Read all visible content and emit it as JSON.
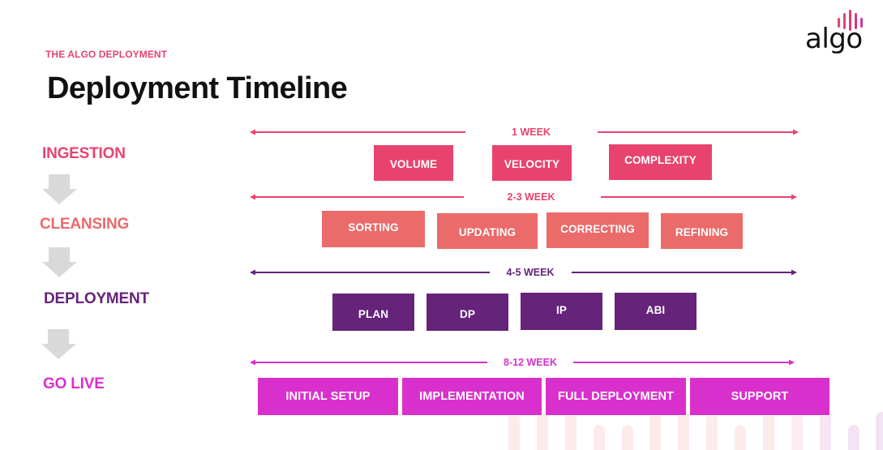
{
  "header": {
    "eyebrow": "THE ALGO DEPLOYMENT",
    "title": "Deployment Timeline",
    "logo_text": "algo"
  },
  "colors": {
    "ingestion": "#e8436e",
    "cleansing": "#eb6a6a",
    "deployment": "#66237a",
    "golive": "#d930cd",
    "connector": "#d9d9d9"
  },
  "stages": [
    {
      "label": "INGESTION"
    },
    {
      "label": "CLEANSING"
    },
    {
      "label": "DEPLOYMENT"
    },
    {
      "label": "GO LIVE"
    }
  ],
  "timeline": [
    {
      "duration": "1 WEEK",
      "steps": [
        "VOLUME",
        "VELOCITY",
        "COMPLEXITY"
      ]
    },
    {
      "duration": "2-3 WEEK",
      "steps": [
        "SORTING",
        "UPDATING",
        "CORRECTING",
        "REFINING"
      ]
    },
    {
      "duration": "4-5 WEEK",
      "steps": [
        "PLAN",
        "DP",
        "IP",
        "ABI"
      ]
    },
    {
      "duration": "8-12 WEEK",
      "steps": [
        "INITIAL SETUP",
        "IMPLEMENTATION",
        "FULL DEPLOYMENT",
        "SUPPORT"
      ]
    }
  ]
}
